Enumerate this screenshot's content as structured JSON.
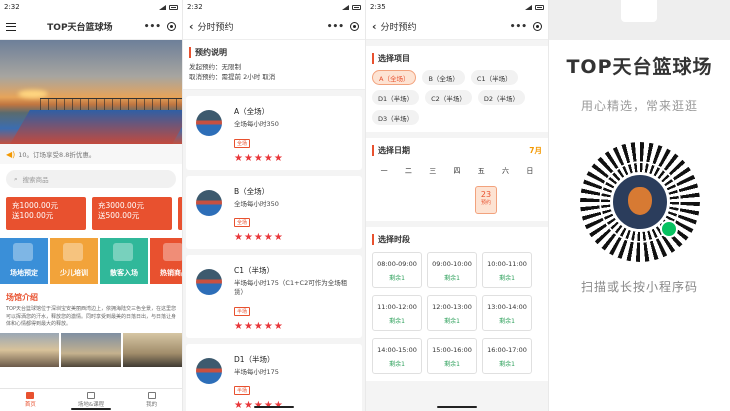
{
  "screens": {
    "home": {
      "status_time": "2:32",
      "nav_title": "TOP天台篮球场",
      "notice": "10。订场享受8.8折优惠。",
      "search_placeholder": "搜索商品",
      "coupons": [
        {
          "line1": "充1000.00元",
          "line2": "送100.00元"
        },
        {
          "line1": "充3000.00元",
          "line2": "送500.00元"
        }
      ],
      "features": [
        {
          "label": "场地预定",
          "color": "#3a8fd8"
        },
        {
          "label": "少儿培训",
          "color": "#f2a33a"
        },
        {
          "label": "散客入场",
          "color": "#30b89a"
        },
        {
          "label": "热销商品",
          "color": "#e8512f"
        }
      ],
      "intro_title": "场馆介绍",
      "intro_text": "TOP天台篮球馆位于深圳宝安美丽西湾边上，依拥海陆交三色全景，在这里您可以挥洒您的汗水，释放您的激情。同时享受到最美的日落日出，与日落让身体和心情都得到最大的释放。",
      "tabs": [
        {
          "label": "首页",
          "active": true
        },
        {
          "label": "场地&课程",
          "active": false
        },
        {
          "label": "我的",
          "active": false
        }
      ]
    },
    "booking": {
      "status_time": "2:32",
      "nav_title": "分时预约",
      "rules_title": "预约说明",
      "rules": [
        "发起预约：无限制",
        "取消预约：需提前 2小时 取消"
      ],
      "courts": [
        {
          "name": "A（全场）",
          "desc": "全场每小时350",
          "tag": "全场",
          "stars": "★★★★★"
        },
        {
          "name": "B（全场）",
          "desc": "全场每小时350",
          "tag": "全场",
          "stars": "★★★★★"
        },
        {
          "name": "C1（半场）",
          "desc": "半场每小时175（C1+C2可作为全场租赁）",
          "tag": "半场",
          "stars": "★★★★★"
        },
        {
          "name": "D1（半场）",
          "desc": "半场每小时175",
          "tag": "半场",
          "stars": "★★★★★"
        }
      ]
    },
    "timeslot": {
      "status_time": "2:35",
      "nav_title": "分时预约",
      "project_title": "选择项目",
      "projects": [
        {
          "label": "A（全场）",
          "selected": true
        },
        {
          "label": "B（全场）",
          "selected": false
        },
        {
          "label": "C1（半场）",
          "selected": false
        },
        {
          "label": "D1（半场）",
          "selected": false
        },
        {
          "label": "C2（半场）",
          "selected": false
        },
        {
          "label": "D2（半场）",
          "selected": false
        },
        {
          "label": "D3（半场）",
          "selected": false
        }
      ],
      "date_title": "选择日期",
      "month": "7月",
      "weekdays": [
        "一",
        "二",
        "三",
        "四",
        "五",
        "六",
        "日"
      ],
      "selected_date": {
        "day": "23",
        "status": "预约"
      },
      "slot_title": "选择时段",
      "slots": [
        {
          "time": "08:00-09:00",
          "remain": "剩余1"
        },
        {
          "time": "09:00-10:00",
          "remain": "剩余1"
        },
        {
          "time": "10:00-11:00",
          "remain": "剩余1"
        },
        {
          "time": "11:00-12:00",
          "remain": "剩余1"
        },
        {
          "time": "12:00-13:00",
          "remain": "剩余1"
        },
        {
          "time": "13:00-14:00",
          "remain": "剩余1"
        },
        {
          "time": "14:00-15:00",
          "remain": "剩余1"
        },
        {
          "time": "15:00-16:00",
          "remain": "剩余1"
        },
        {
          "time": "16:00-17:00",
          "remain": "剩余1"
        }
      ]
    },
    "promo": {
      "title": "TOP天台篮球场",
      "subtitle": "用心精选，常来逛逛",
      "hint": "扫描或长按小程序码"
    }
  },
  "colors": {
    "accent": "#e8512f",
    "remain_green": "#2ca05a",
    "month_orange": "#f39800"
  }
}
